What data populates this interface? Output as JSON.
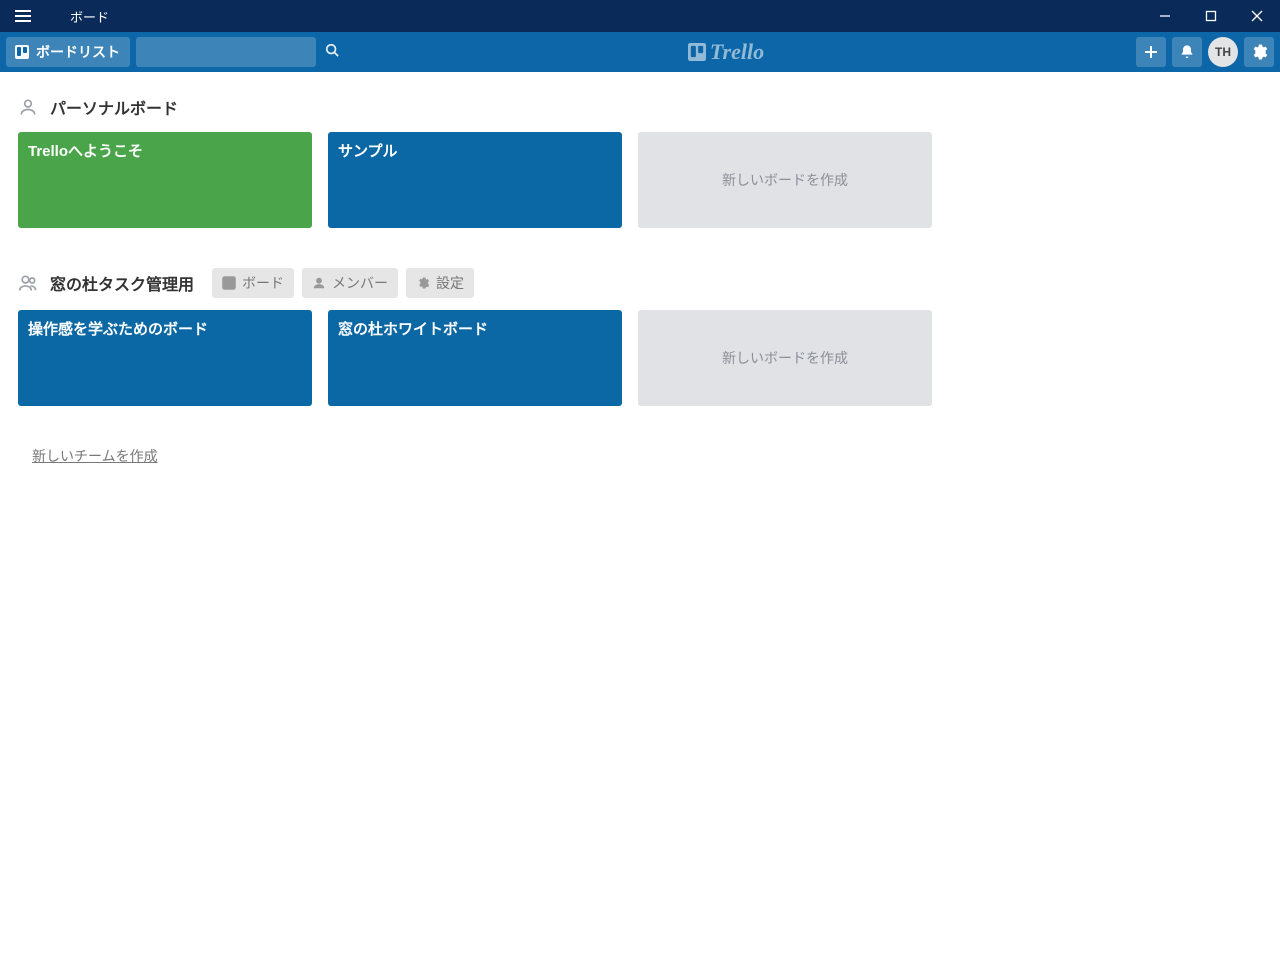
{
  "titlebar": {
    "title": "ボード"
  },
  "header": {
    "boards_button": "ボードリスト",
    "search_placeholder": "",
    "logo_text": "Trello",
    "avatar_initials": "TH"
  },
  "sections": {
    "personal": {
      "title": "パーソナルボード",
      "boards": [
        {
          "name": "Trelloへようこそ",
          "color": "green"
        },
        {
          "name": "サンプル",
          "color": "blue"
        }
      ],
      "new_board_label": "新しいボードを作成"
    },
    "team1": {
      "title": "窓の杜タスク管理用",
      "actions": {
        "boards": "ボード",
        "members": "メンバー",
        "settings": "設定"
      },
      "boards": [
        {
          "name": "操作感を学ぶためのボード",
          "color": "blue"
        },
        {
          "name": "窓の杜ホワイトボード",
          "color": "blue"
        }
      ],
      "new_board_label": "新しいボードを作成"
    }
  },
  "new_team_label": "新しいチームを作成"
}
